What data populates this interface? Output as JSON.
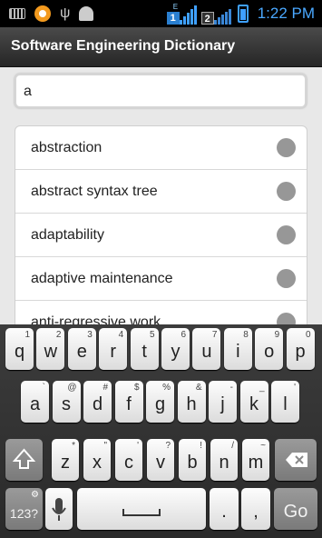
{
  "status_bar": {
    "time": "1:22 PM",
    "network1": "1",
    "network1_type": "E",
    "network2": "2",
    "icons": [
      "keyboard-icon",
      "orange-app-icon",
      "usb-icon",
      "android-debug-icon",
      "signal-icon",
      "signal2-icon",
      "battery-charging-icon"
    ]
  },
  "app": {
    "title": "Software Engineering Dictionary"
  },
  "search": {
    "value": "a"
  },
  "results": [
    {
      "term": "abstraction"
    },
    {
      "term": "abstract syntax tree"
    },
    {
      "term": "adaptability"
    },
    {
      "term": "adaptive maintenance"
    },
    {
      "term": "anti-regressive work"
    }
  ],
  "keyboard": {
    "row1": [
      {
        "key": "q",
        "hint": "1"
      },
      {
        "key": "w",
        "hint": "2"
      },
      {
        "key": "e",
        "hint": "3"
      },
      {
        "key": "r",
        "hint": "4"
      },
      {
        "key": "t",
        "hint": "5"
      },
      {
        "key": "y",
        "hint": "6"
      },
      {
        "key": "u",
        "hint": "7"
      },
      {
        "key": "i",
        "hint": "8"
      },
      {
        "key": "o",
        "hint": "9"
      },
      {
        "key": "p",
        "hint": "0"
      }
    ],
    "row2": [
      {
        "key": "a",
        "hint": "`"
      },
      {
        "key": "s",
        "hint": "@"
      },
      {
        "key": "d",
        "hint": "#"
      },
      {
        "key": "f",
        "hint": "$"
      },
      {
        "key": "g",
        "hint": "%"
      },
      {
        "key": "h",
        "hint": "&"
      },
      {
        "key": "j",
        "hint": "-"
      },
      {
        "key": "k",
        "hint": "_"
      },
      {
        "key": "l",
        "hint": "'"
      }
    ],
    "row3": [
      {
        "key": "z",
        "hint": "*"
      },
      {
        "key": "x",
        "hint": "\""
      },
      {
        "key": "c",
        "hint": "'"
      },
      {
        "key": "v",
        "hint": "?"
      },
      {
        "key": "b",
        "hint": "!"
      },
      {
        "key": "n",
        "hint": "/"
      },
      {
        "key": "m",
        "hint": "~"
      }
    ],
    "symbols_label": "123?",
    "period": ".",
    "comma": ",",
    "go_label": "Go"
  }
}
